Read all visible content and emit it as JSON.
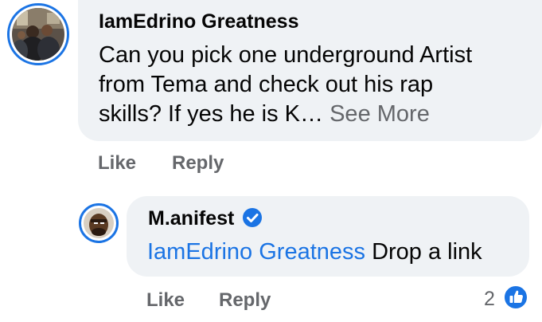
{
  "comment": {
    "author": "IamEdrino Greatness",
    "text_line1": "Can you pick one underground Artist",
    "text_line2": "from Tema and check out his rap",
    "text_line3_start": "skills? If yes he is K… ",
    "see_more": "See More",
    "like_label": "Like",
    "reply_label": "Reply"
  },
  "reply": {
    "author": "M.anifest",
    "verified": true,
    "mention": "IamEdrino Greatness",
    "text": " Drop a link",
    "like_label": "Like",
    "reply_label": "Reply",
    "reaction_count": "2",
    "reaction_icon": "thumbs-up-icon"
  },
  "colors": {
    "accent": "#1b74e4",
    "bubble": "#eff2f5",
    "secondary_text": "#65676b"
  }
}
